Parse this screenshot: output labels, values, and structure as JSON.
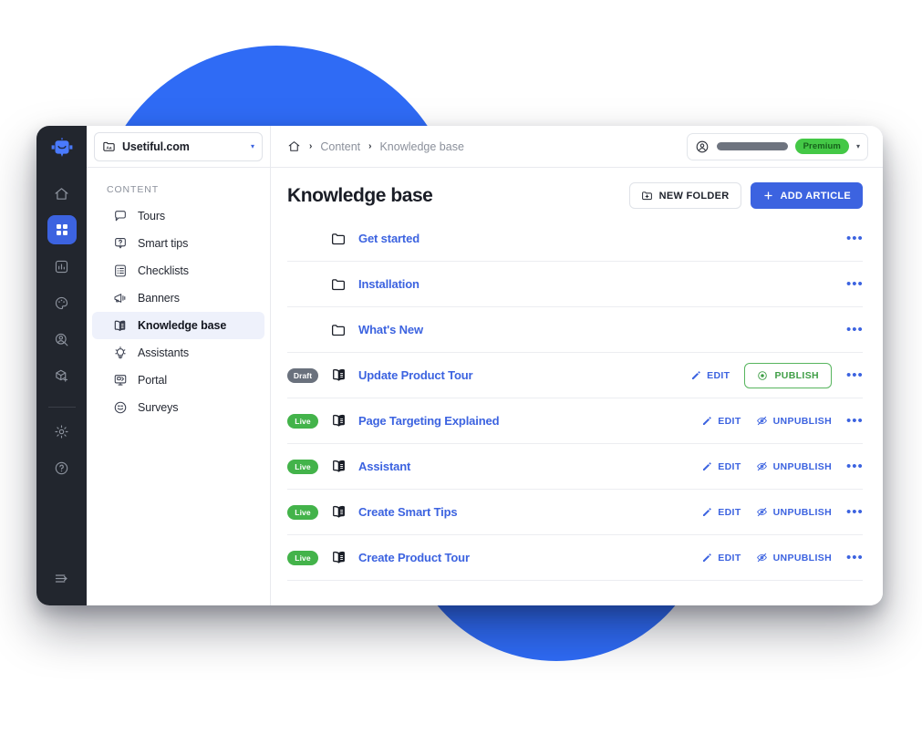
{
  "window": {
    "workspace": {
      "name": "Usetiful.com",
      "icon": "folder-aa-icon",
      "caret": "▾"
    },
    "rail": {
      "logo_icon": "usetiful-robot-logo",
      "items": [
        {
          "name": "home",
          "icon": "home-icon",
          "active": false
        },
        {
          "name": "content",
          "icon": "grid-icon",
          "active": true
        },
        {
          "name": "analytics",
          "icon": "bar-chart-icon",
          "active": false
        },
        {
          "name": "themes",
          "icon": "palette-icon",
          "active": false
        },
        {
          "name": "audience",
          "icon": "user-search-icon",
          "active": false
        },
        {
          "name": "integrations",
          "icon": "cube-plus-icon",
          "active": false
        }
      ],
      "bottom_items": [
        {
          "name": "settings",
          "icon": "gear-icon"
        },
        {
          "name": "help",
          "icon": "question-circle-icon"
        }
      ],
      "collapse": {
        "name": "collapse-sidebar",
        "icon": "collapse-arrow-icon"
      }
    },
    "nav": {
      "section_label": "CONTENT",
      "items": [
        {
          "label": "Tours",
          "icon": "speech-bubble-icon",
          "active": false
        },
        {
          "label": "Smart tips",
          "icon": "tooltip-question-icon",
          "active": false
        },
        {
          "label": "Checklists",
          "icon": "checklist-icon",
          "active": false
        },
        {
          "label": "Banners",
          "icon": "megaphone-icon",
          "active": false
        },
        {
          "label": "Knowledge base",
          "icon": "open-book-icon",
          "active": true
        },
        {
          "label": "Assistants",
          "icon": "lightbulb-icon",
          "active": false
        },
        {
          "label": "Portal",
          "icon": "monitor-icon",
          "active": false
        },
        {
          "label": "Surveys",
          "icon": "smiley-icon",
          "active": false
        }
      ]
    },
    "topbar": {
      "breadcrumb": {
        "home_icon": "home-icon",
        "separator": "›",
        "items": [
          "Content",
          "Knowledge base"
        ]
      },
      "account": {
        "avatar_icon": "user-circle-icon",
        "name_redacted": true,
        "plan_badge": "Premium",
        "caret": "▾"
      }
    },
    "page": {
      "title": "Knowledge base",
      "actions": [
        {
          "id": "new-folder",
          "label": "NEW FOLDER",
          "icon": "folder-plus-icon",
          "style": "secondary"
        },
        {
          "id": "add-article",
          "label": "ADD ARTICLE",
          "icon": "plus-icon",
          "style": "primary"
        }
      ]
    },
    "list": {
      "kebab_glyph": "•••",
      "rows": [
        {
          "type": "folder",
          "icon": "folder-icon",
          "status": null,
          "title": "Get started",
          "actions": []
        },
        {
          "type": "folder",
          "icon": "folder-icon",
          "status": null,
          "title": "Installation",
          "actions": []
        },
        {
          "type": "folder",
          "icon": "folder-icon",
          "status": null,
          "title": "What's New",
          "actions": []
        },
        {
          "type": "article",
          "icon": "open-book-icon",
          "status": "Draft",
          "title": "Update Product Tour",
          "actions": [
            {
              "id": "edit",
              "label": "EDIT",
              "icon": "pencil-icon",
              "style": "link"
            },
            {
              "id": "publish",
              "label": "PUBLISH",
              "icon": "publish-eye-icon",
              "style": "outline-green"
            }
          ]
        },
        {
          "type": "article",
          "icon": "open-book-icon",
          "status": "Live",
          "title": "Page Targeting Explained",
          "actions": [
            {
              "id": "edit",
              "label": "EDIT",
              "icon": "pencil-icon",
              "style": "link"
            },
            {
              "id": "unpublish",
              "label": "UNPUBLISH",
              "icon": "eye-slash-icon",
              "style": "link"
            }
          ]
        },
        {
          "type": "article",
          "icon": "open-book-icon",
          "status": "Live",
          "title": "Assistant",
          "actions": [
            {
              "id": "edit",
              "label": "EDIT",
              "icon": "pencil-icon",
              "style": "link"
            },
            {
              "id": "unpublish",
              "label": "UNPUBLISH",
              "icon": "eye-slash-icon",
              "style": "link"
            }
          ]
        },
        {
          "type": "article",
          "icon": "open-book-icon",
          "status": "Live",
          "title": "Create Smart Tips",
          "actions": [
            {
              "id": "edit",
              "label": "EDIT",
              "icon": "pencil-icon",
              "style": "link"
            },
            {
              "id": "unpublish",
              "label": "UNPUBLISH",
              "icon": "eye-slash-icon",
              "style": "link"
            }
          ]
        },
        {
          "type": "article",
          "icon": "open-book-icon",
          "status": "Live",
          "title": "Create Product Tour",
          "actions": [
            {
              "id": "edit",
              "label": "EDIT",
              "icon": "pencil-icon",
              "style": "link"
            },
            {
              "id": "unpublish",
              "label": "UNPUBLISH",
              "icon": "eye-slash-icon",
              "style": "link"
            }
          ]
        }
      ]
    }
  },
  "colors": {
    "brand_blue": "#3c63e0",
    "bg_circle_blue": "#2f6bf5",
    "rail_dark": "#22262e",
    "live_green": "#43b34a",
    "premium_green": "#44c846",
    "draft_gray": "#6a717d"
  }
}
